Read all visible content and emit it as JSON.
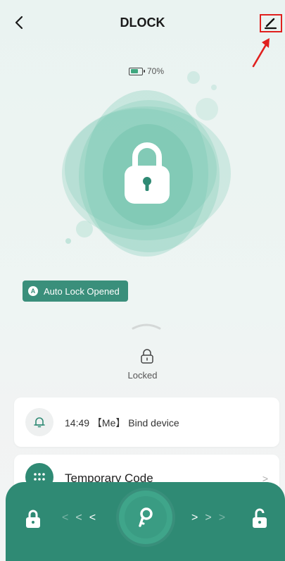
{
  "header": {
    "title": "DLOCK",
    "back_icon": "chevron-left-icon",
    "edit_icon": "edit-pencil-icon",
    "annotation_color": "#e0201e"
  },
  "battery": {
    "label": "70%",
    "level_percent": 70
  },
  "lock_status": {
    "auto_lock_badge": "A",
    "auto_lock_label": "Auto Lock Opened",
    "state_label": "Locked"
  },
  "log": {
    "text": "14:49 【Me】 Bind device",
    "icon": "bell-icon"
  },
  "temporary_code": {
    "label": "Temporary Code",
    "icon": "keypad-dots-icon",
    "chevron": ">"
  },
  "bottom_bar": {
    "left_arrows": "< < <",
    "right_arrows": "> > >",
    "left_icon": "lock-closed-icon",
    "right_icon": "lock-open-icon",
    "center_icon": "key-icon"
  },
  "colors": {
    "accent": "#2f8a74",
    "bubble": "#5fbfa6",
    "badge": "#3a8f7b"
  }
}
